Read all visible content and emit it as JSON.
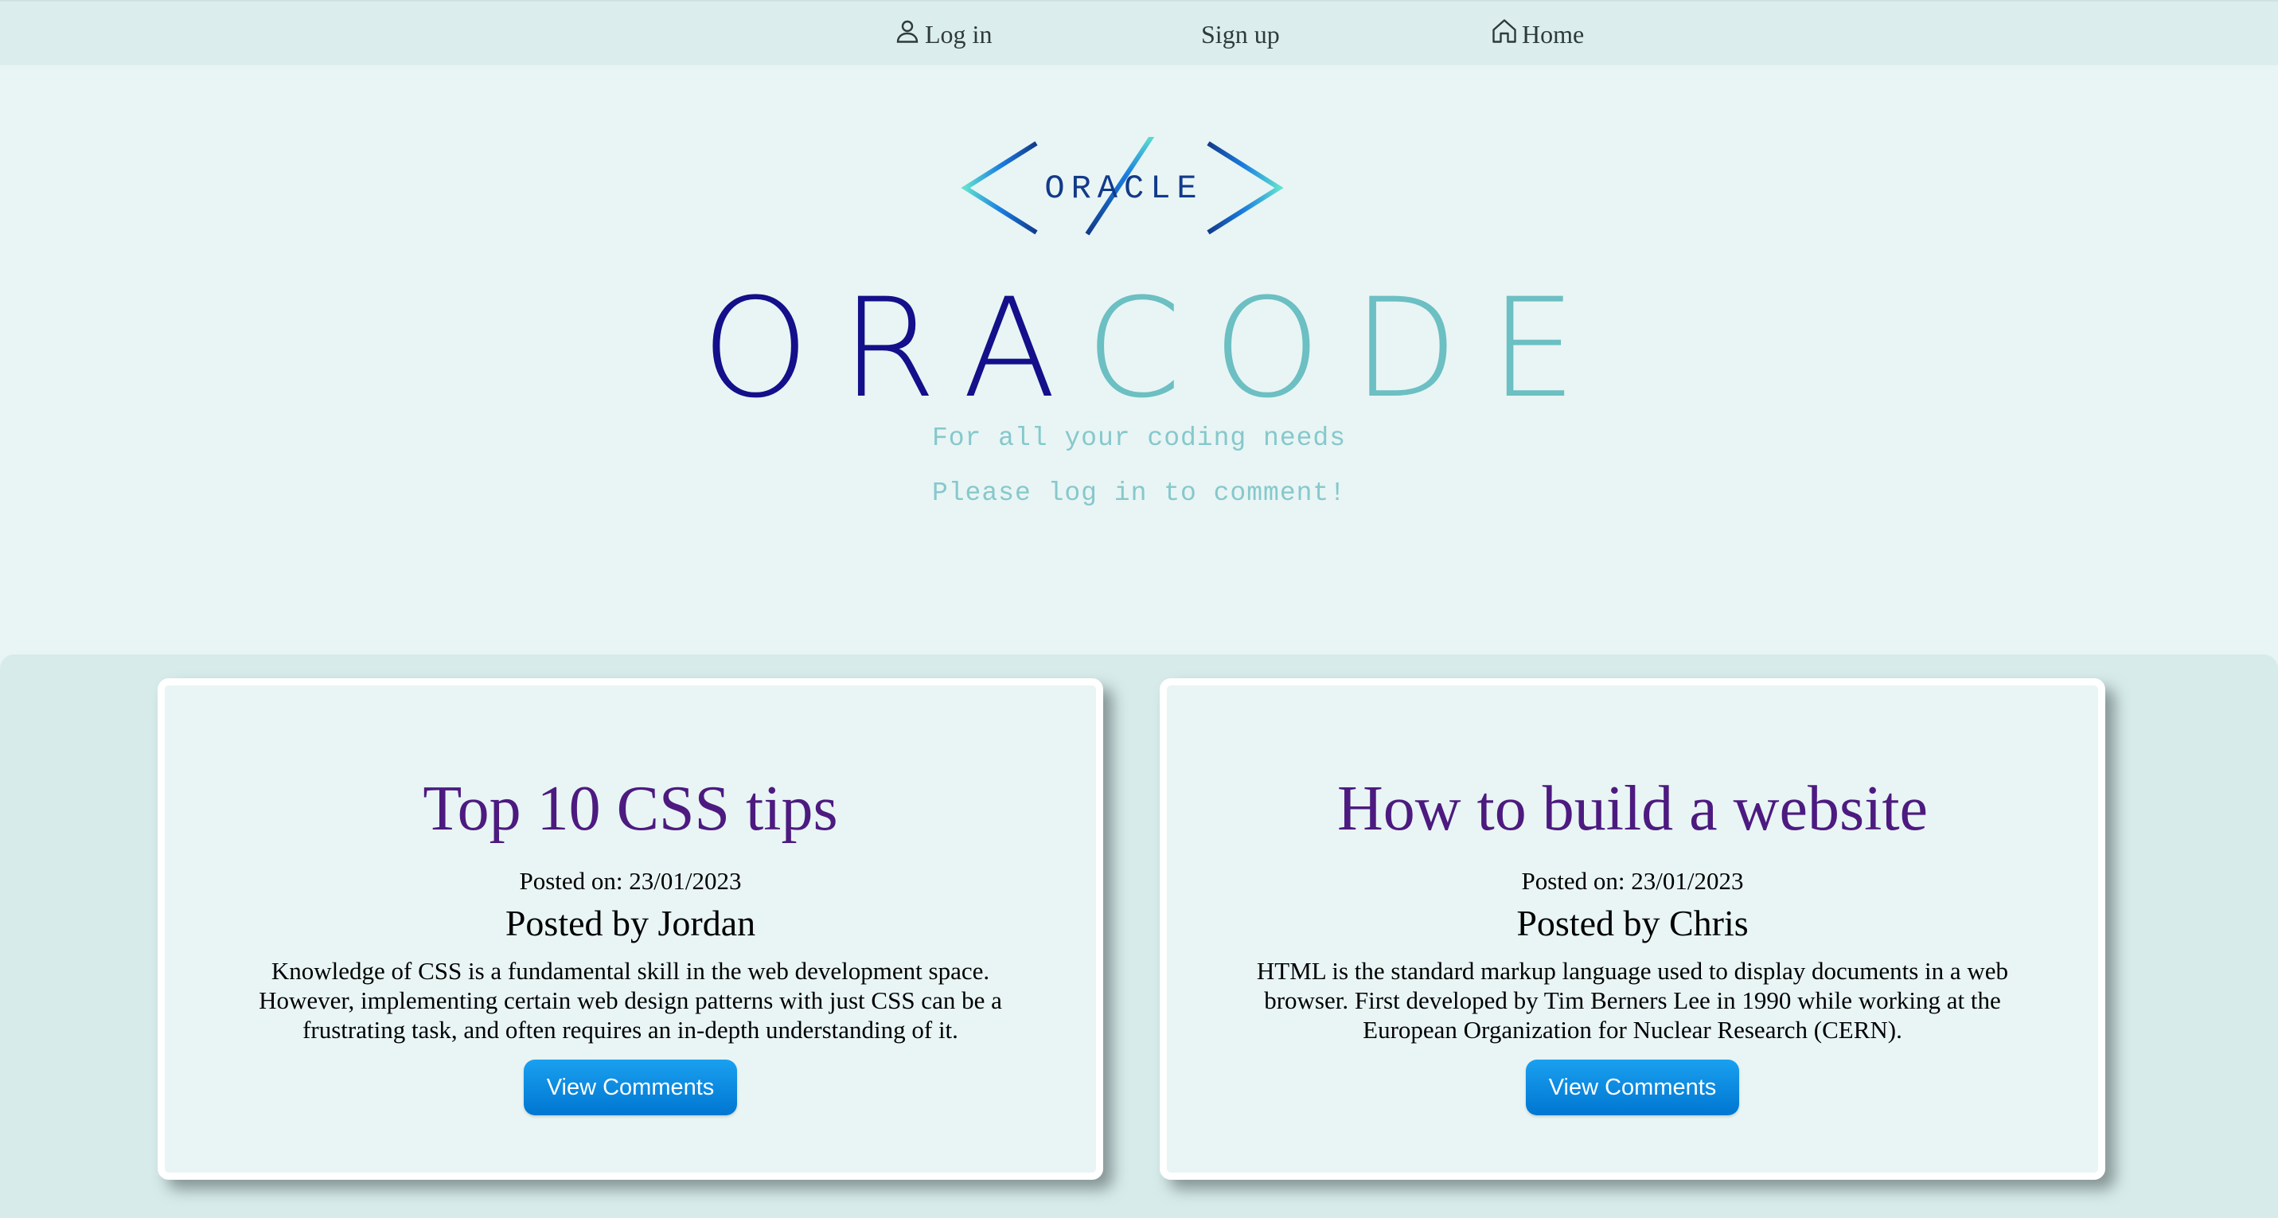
{
  "nav": {
    "login_label": "Log in",
    "signup_label": "Sign up",
    "home_label": "Home"
  },
  "hero": {
    "logo_text": "ORACLE",
    "title_part1": "ORA",
    "title_part2": "CODE",
    "tagline": "For all your coding needs",
    "login_prompt": "Please log in to comment!"
  },
  "colors": {
    "nav_bg": "#dbeeed",
    "page_bg": "#e8f5f4",
    "title_dark": "#140f8a",
    "title_light": "#6cbfc2",
    "post_title": "#4d1a80",
    "button": "#0a8ae0"
  },
  "posts": [
    {
      "title": "Top 10 CSS tips",
      "date": "Posted on: 23/01/2023",
      "author": "Posted by Jordan",
      "body": "Knowledge of CSS is a fundamental skill in the web development space. However, implementing certain web design patterns with just CSS can be a frustrating task, and often requires an in-depth understanding of it.",
      "button_label": "View Comments"
    },
    {
      "title": "How to build a website",
      "date": "Posted on: 23/01/2023",
      "author": "Posted by Chris",
      "body": "HTML is the standard markup language used to display documents in a web browser. First developed by Tim Berners Lee in 1990 while working at the European Organization for Nuclear Research (CERN).",
      "button_label": "View Comments"
    }
  ]
}
